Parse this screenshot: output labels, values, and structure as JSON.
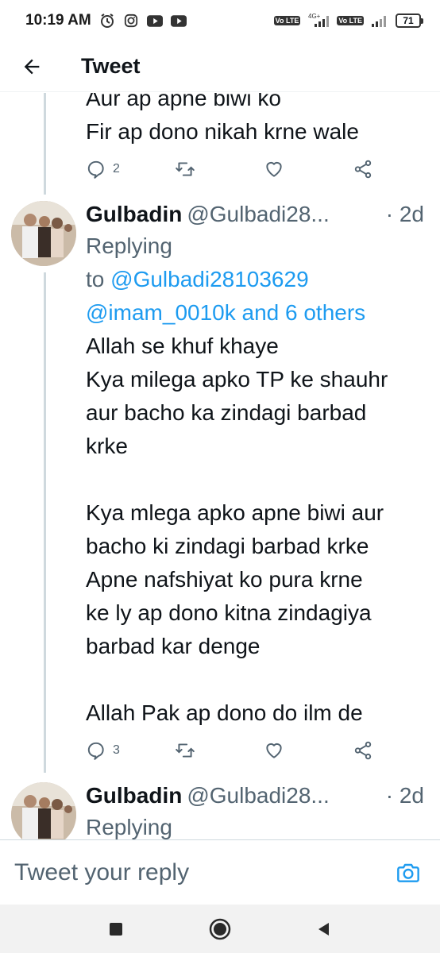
{
  "status": {
    "time": "10:19 AM",
    "network": "4G+",
    "volte1": "Vo LTE",
    "volte2": "Vo LTE",
    "battery": "71"
  },
  "header": {
    "title": "Tweet"
  },
  "prev_tweet": {
    "partial_line": "Aur ap apne biwi ko",
    "last_line": "Fir ap dono nikah krne wale",
    "reply_count": "2"
  },
  "tweet1": {
    "display_name": "Gulbadin",
    "handle": "@Gulbadi28...",
    "time": "· 2d",
    "replying_prefix": "Replying",
    "replying_to": "to",
    "mention1": "@Gulbadi28103629",
    "mention2": "@imam_0010k and 6 others",
    "text": "Allah se khuf khaye\nKya milega apko TP ke shauhr\naur bacho ka zindagi barbad\nkrke\n\nKya mlega apko apne biwi aur\nbacho ki zindagi barbad krke\nApne nafshiyat ko pura krne\nke ly ap dono kitna zindagiya\nbarbad kar denge\n\nAllah Pak ap dono do ilm de",
    "reply_count": "3"
  },
  "tweet2": {
    "display_name": "Gulbadin",
    "handle": "@Gulbadi28...",
    "time": "· 2d",
    "replying_prefix": "Replying"
  },
  "reply_bar": {
    "placeholder": "Tweet your reply"
  },
  "icons": {
    "back": "arrow-left-icon",
    "reply": "reply-icon",
    "retweet": "retweet-icon",
    "like": "heart-icon",
    "share": "share-icon",
    "camera": "camera-icon"
  },
  "colors": {
    "link": "#1d9bf0",
    "secondary": "#536471",
    "text": "#0f1419"
  }
}
